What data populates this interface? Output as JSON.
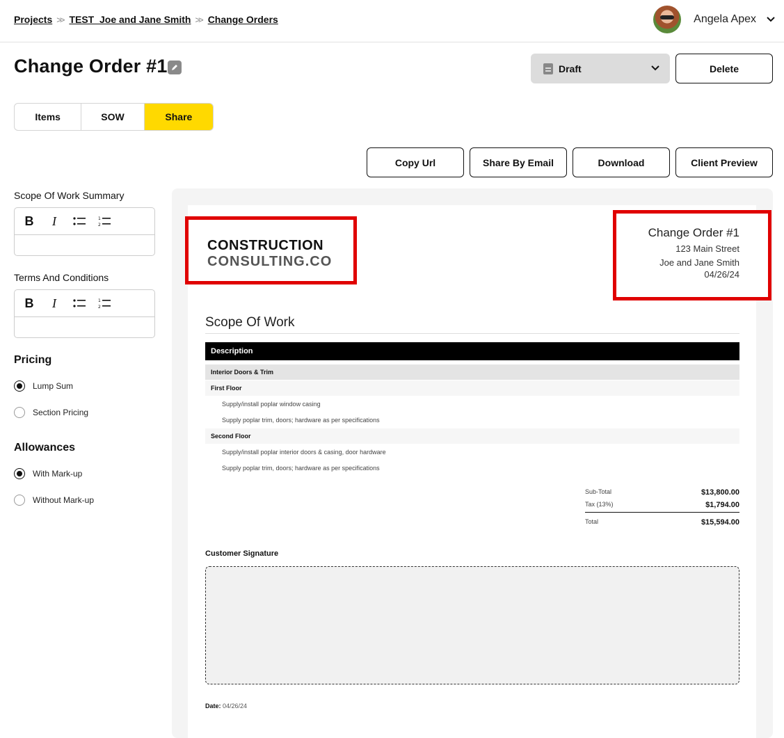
{
  "breadcrumb": [
    "Projects",
    "TEST_Joe and Jane Smith",
    "Change Orders"
  ],
  "user": {
    "name": "Angela Apex"
  },
  "page": {
    "title": "Change Order #1"
  },
  "status": {
    "value": "Draft"
  },
  "actions": {
    "delete": "Delete",
    "copy_url": "Copy Url",
    "share_email": "Share By Email",
    "download": "Download",
    "client_preview": "Client Preview"
  },
  "tabs": [
    {
      "label": "Items",
      "active": false
    },
    {
      "label": "SOW",
      "active": false
    },
    {
      "label": "Share",
      "active": true
    }
  ],
  "left": {
    "sow_summary_label": "Scope Of Work Summary",
    "terms_label": "Terms And Conditions",
    "pricing_title": "Pricing",
    "pricing_options": [
      "Lump Sum",
      "Section Pricing"
    ],
    "pricing_selected": "Lump Sum",
    "allowances_title": "Allowances",
    "allowance_options": [
      "With Mark-up",
      "Without Mark-up"
    ],
    "allowance_selected": "With Mark-up"
  },
  "document": {
    "logo_line1": "CONSTRUCTION",
    "logo_line2": "CONSULTING.CO",
    "title": "Change Order #1",
    "address": "123 Main Street",
    "client": "Joe and Jane Smith",
    "date": "04/26/24",
    "sow_title": "Scope Of Work",
    "table_header": "Description",
    "rows": [
      {
        "type": "section",
        "text": "Interior Doors & Trim"
      },
      {
        "type": "sub",
        "text": "First Floor"
      },
      {
        "type": "item",
        "text": "Supply/install poplar window casing"
      },
      {
        "type": "item",
        "text": "Supply poplar trim, doors; hardware as per specifications"
      },
      {
        "type": "sub",
        "text": "Second Floor"
      },
      {
        "type": "item",
        "text": "Supply/install poplar interior doors & casing, door hardware"
      },
      {
        "type": "item",
        "text": "Supply poplar trim, doors; hardware as per specifications"
      }
    ],
    "subtotal_label": "Sub-Total",
    "subtotal": "$13,800.00",
    "tax_label": "Tax (13%)",
    "tax": "$1,794.00",
    "total_label": "Total",
    "total": "$15,594.00",
    "signature_label": "Customer Signature",
    "date_label": "Date:",
    "date_value": "04/26/24"
  },
  "colors": {
    "accent": "#ffd900",
    "highlight": "#e00000"
  }
}
